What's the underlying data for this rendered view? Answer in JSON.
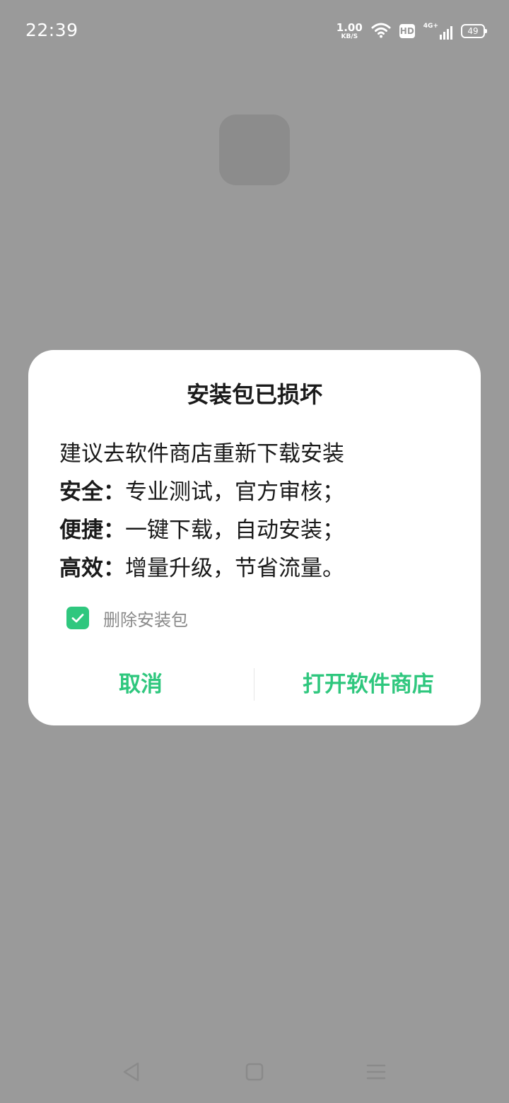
{
  "status_bar": {
    "time": "22:39",
    "net_speed_value": "1.00",
    "net_speed_unit": "KB/S",
    "hd_label": "HD",
    "signal_label": "4G+",
    "battery_level": "49",
    "icons": [
      "wifi-icon",
      "hd-icon",
      "signal-icon",
      "battery-icon"
    ]
  },
  "dialog": {
    "title": "安装包已损坏",
    "message": "建议去软件商店重新下载安装",
    "features": [
      {
        "key": "安全：",
        "text": "专业测试，官方审核；"
      },
      {
        "key": "便捷：",
        "text": "一键下载，自动安装；"
      },
      {
        "key": "高效：",
        "text": "增量升级，节省流量。"
      }
    ],
    "checkbox": {
      "label": "删除安装包",
      "checked": true
    },
    "buttons": {
      "cancel": "取消",
      "open_store": "打开软件商店"
    }
  },
  "nav_bar": {
    "icons": [
      "back-icon",
      "home-icon",
      "menu-icon"
    ]
  },
  "colors": {
    "accent": "#2fc77e",
    "scrim": "#9a9a9a",
    "dialog_bg": "#ffffff",
    "text_primary": "#1a1a1a",
    "text_secondary": "#8a8a8a"
  }
}
